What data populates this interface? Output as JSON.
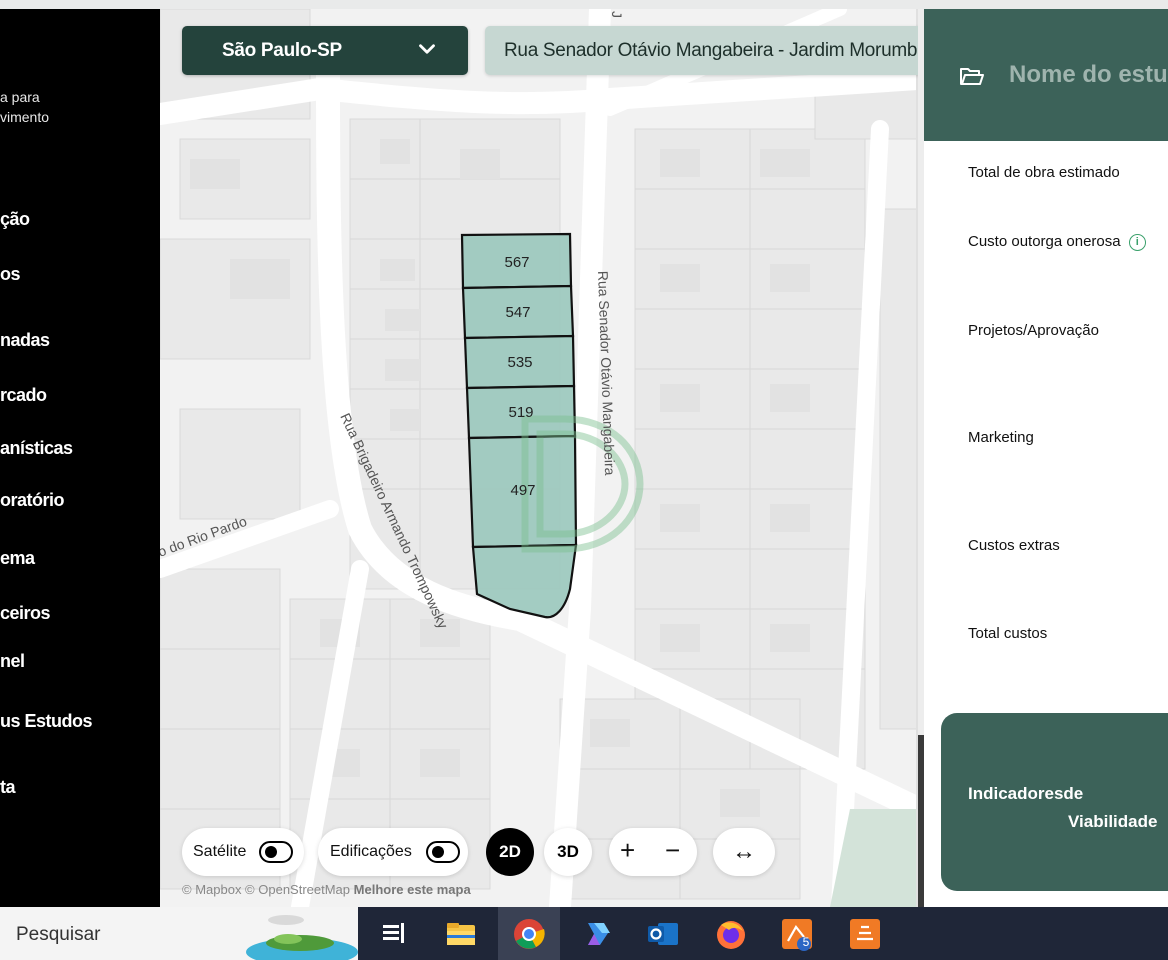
{
  "sidebar": {
    "tagline": "a para\nvimento",
    "items": [
      {
        "label": "ção"
      },
      {
        "label": "os"
      },
      {
        "label": "nadas"
      },
      {
        "label": "rcado"
      },
      {
        "label": "anísticas"
      },
      {
        "label": "oratório"
      },
      {
        "label": "ema"
      },
      {
        "label": "ceiros"
      },
      {
        "label": "nel"
      },
      {
        "label": "us Estudos"
      },
      {
        "label": "ta"
      }
    ]
  },
  "map": {
    "city_select": {
      "value": "São Paulo-SP",
      "icon": "chevron-down-icon"
    },
    "address": {
      "value": "Rua Senador Otávio Mangabeira - Jardim Morumbi"
    },
    "lots": [
      "567",
      "547",
      "535",
      "519",
      "497"
    ],
    "street_labels": {
      "senador": "Rua Senador Otávio Mangabeira",
      "brigadeiro": "Rua Brigadeiro Armando Trompowsky",
      "rio_pardo": "o do Rio Pardo",
      "top_partial": "J"
    },
    "controls": {
      "satellite_label": "Satélite",
      "buildings_label": "Edificações",
      "btn_2d": "2D",
      "btn_3d": "3D",
      "zoom_in": "+",
      "zoom_out": "−",
      "expand": "↔"
    },
    "attribution": {
      "prefix": "© Mapbox © OpenStreetMap",
      "link": "Melhore este mapa"
    }
  },
  "panel": {
    "title": "Nome do estudo",
    "title_icon": "folder-open-icon",
    "rows": [
      {
        "label": "Total de obra estimado"
      },
      {
        "label": "Custo outorga onerosa"
      },
      {
        "label": "Projetos/Aprovação"
      },
      {
        "label": "Marketing"
      },
      {
        "label": "Custos extras"
      },
      {
        "label": "Total custos"
      }
    ],
    "info_glyph": "i",
    "indicators": {
      "line1": "Indicadoresde",
      "line2": "Viabilidade"
    }
  },
  "taskbar": {
    "search_placeholder": "Pesquisar",
    "icons": [
      "task-view-icon",
      "file-explorer-icon",
      "chrome-icon",
      "copilot-icon",
      "outlook-icon",
      "firefox-icon",
      "app-icon",
      "app-icon"
    ],
    "badge": "5"
  },
  "colors": {
    "brand_dark": "#24433c",
    "brand": "#3c6259",
    "lot_fill": "#9ec9bf",
    "address_bg": "#c6d7d2"
  }
}
